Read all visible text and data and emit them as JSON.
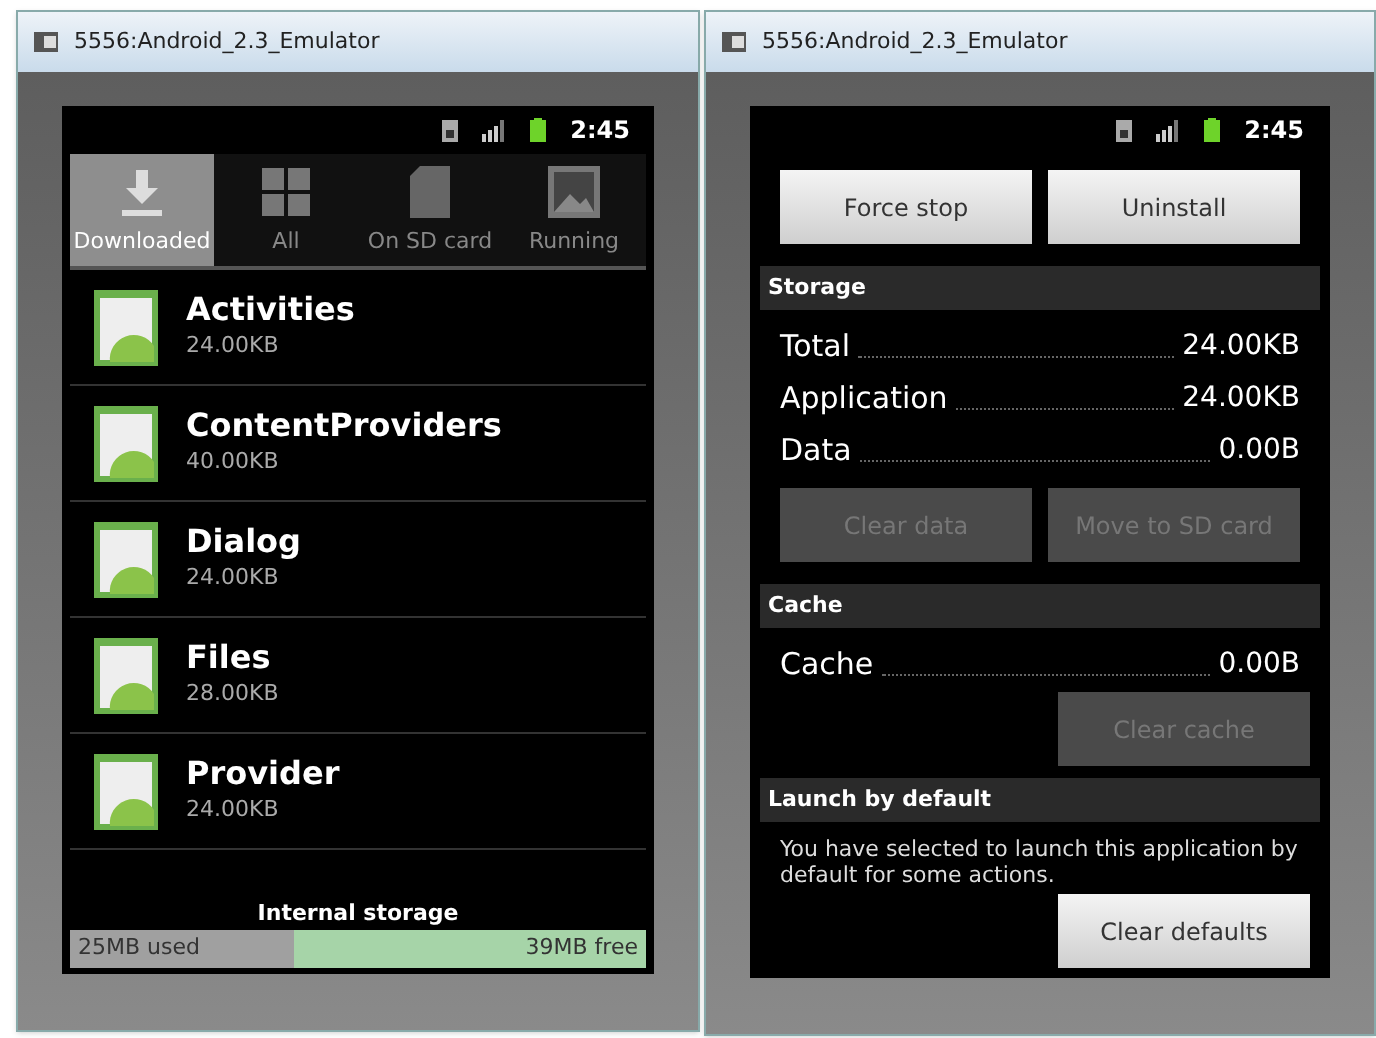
{
  "windows": [
    {
      "title": "5556:Android_2.3_Emulator",
      "status": {
        "time": "2:45"
      },
      "tabs": [
        {
          "label": "Downloaded",
          "selected": true
        },
        {
          "label": "All",
          "selected": false
        },
        {
          "label": "On SD card",
          "selected": false
        },
        {
          "label": "Running",
          "selected": false
        }
      ],
      "apps": [
        {
          "name": "Activities",
          "size": "24.00KB"
        },
        {
          "name": "ContentProviders",
          "size": "40.00KB"
        },
        {
          "name": "Dialog",
          "size": "24.00KB"
        },
        {
          "name": "Files",
          "size": "28.00KB"
        },
        {
          "name": "Provider",
          "size": "24.00KB"
        }
      ],
      "storage": {
        "title": "Internal storage",
        "used": "25MB used",
        "free": "39MB free",
        "level": 0.39
      }
    },
    {
      "title": "5556:Android_2.3_Emulator",
      "status": {
        "time": "2:45"
      },
      "sections": [
        {
          "kind": "buttons",
          "buttons": [
            {
              "label": "Force stop",
              "disabled": false
            },
            {
              "label": "Uninstall",
              "disabled": false
            }
          ]
        },
        {
          "kind": "header",
          "label": "Storage"
        },
        {
          "kind": "row",
          "label": "Total",
          "value": "24.00KB"
        },
        {
          "kind": "row",
          "label": "Application",
          "value": "24.00KB"
        },
        {
          "kind": "row",
          "label": "Data",
          "value": "0.00B"
        },
        {
          "kind": "buttons",
          "buttons": [
            {
              "label": "Clear data",
              "disabled": true
            },
            {
              "label": "Move to SD card",
              "disabled": true
            }
          ]
        },
        {
          "kind": "header",
          "label": "Cache"
        },
        {
          "kind": "row",
          "label": "Cache",
          "value": "0.00B"
        },
        {
          "kind": "button_right",
          "buttons": [
            {
              "label": "Clear cache",
              "disabled": true
            }
          ]
        },
        {
          "kind": "header",
          "label": "Launch by default"
        },
        {
          "kind": "text",
          "text": "You have selected to launch this application by default for some actions."
        },
        {
          "kind": "button_right",
          "buttons": [
            {
              "label": "Clear defaults",
              "disabled": false
            }
          ]
        }
      ]
    }
  ]
}
